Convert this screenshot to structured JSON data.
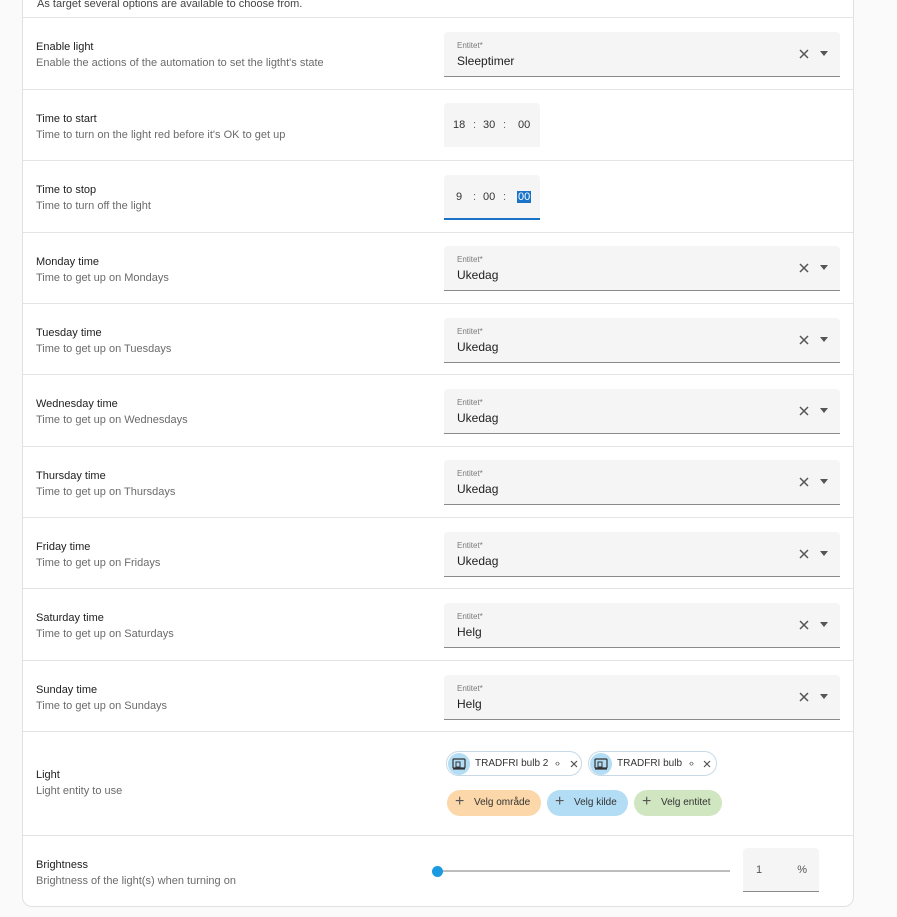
{
  "top_snippet": "As target several options are available to choose from.",
  "rows": {
    "enable_light": {
      "title": "Enable light",
      "desc": "Enable the actions of the automation to set the ligtht's state",
      "label": "Entitet*",
      "value": "Sleeptimer"
    },
    "time_start": {
      "title": "Time to start",
      "desc": "Time to turn on the light red before it's OK to get up",
      "h": "18",
      "m": "30",
      "s": "00"
    },
    "time_stop": {
      "title": "Time to stop",
      "desc": "Time to turn off the light",
      "h": "9",
      "m": "00",
      "s": "00"
    },
    "monday": {
      "title": "Monday time",
      "desc": "Time to get up on Mondays",
      "label": "Entitet*",
      "value": "Ukedag"
    },
    "tuesday": {
      "title": "Tuesday time",
      "desc": "Time to get up on Tuesdays",
      "label": "Entitet*",
      "value": "Ukedag"
    },
    "wednesday": {
      "title": "Wednesday time",
      "desc": "Time to get up on Wednesdays",
      "label": "Entitet*",
      "value": "Ukedag"
    },
    "thursday": {
      "title": "Thursday time",
      "desc": "Time to get up on Thursdays",
      "label": "Entitet*",
      "value": "Ukedag"
    },
    "friday": {
      "title": "Friday time",
      "desc": "Time to get up on Fridays",
      "label": "Entitet*",
      "value": "Ukedag"
    },
    "saturday": {
      "title": "Saturday time",
      "desc": "Time to get up on Saturdays",
      "label": "Entitet*",
      "value": "Helg"
    },
    "sunday": {
      "title": "Sunday time",
      "desc": "Time to get up on Sundays",
      "label": "Entitet*",
      "value": "Helg"
    },
    "light": {
      "title": "Light",
      "desc": "Light entity to use",
      "chips": [
        {
          "label": "TRADFRI bulb 2"
        },
        {
          "label": "TRADFRI bulb"
        }
      ],
      "add_area": "Velg område",
      "add_device": "Velg kilde",
      "add_entity": "Velg entitet"
    },
    "brightness": {
      "title": "Brightness",
      "desc": "Brightness of the light(s) when turning on",
      "value": "1",
      "unit": "%",
      "level_percent": 1
    }
  },
  "colors": {
    "accent": "#1a73c8",
    "area_chip": "#fbd7a9",
    "device_chip": "#b3ddf5",
    "entity_chip": "#cfe6c0"
  }
}
